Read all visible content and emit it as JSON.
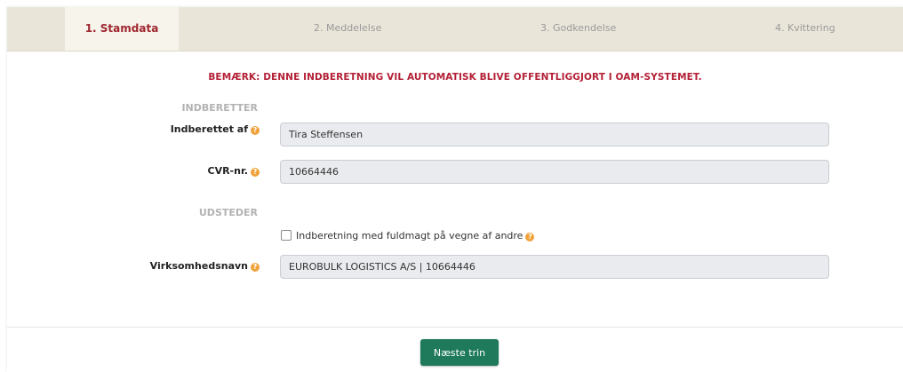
{
  "steps": [
    {
      "label": "1. Stamdata",
      "active": true
    },
    {
      "label": "2. Meddelelse",
      "active": false
    },
    {
      "label": "3. Godkendelse",
      "active": false
    },
    {
      "label": "4. Kvittering",
      "active": false
    }
  ],
  "notice": "BEMÆRK: DENNE INDBERETNING VIL AUTOMATISK BLIVE OFFENTLIGGJORT I OAM-SYSTEMET.",
  "sections": {
    "indberetter": "INDBERETTER",
    "udsteder": "UDSTEDER"
  },
  "fields": {
    "indberettet_af": {
      "label": "Indberettet af",
      "value": "Tira Steffensen"
    },
    "cvr": {
      "label": "CVR-nr.",
      "value": "10664446"
    },
    "virksomhedsnavn": {
      "label": "Virksomhedsnavn",
      "value": "EUROBULK LOGISTICS A/S | 10664446"
    }
  },
  "checkbox": {
    "label": "Indberetning med fuldmagt på vegne af andre",
    "checked": false
  },
  "icons": {
    "help": "?"
  },
  "buttons": {
    "next": "Næste trin"
  },
  "colors": {
    "accent_red": "#b32036",
    "step_bar": "#eae5d9",
    "button_green": "#1e7a5a",
    "help_orange": "#f0a23a"
  }
}
